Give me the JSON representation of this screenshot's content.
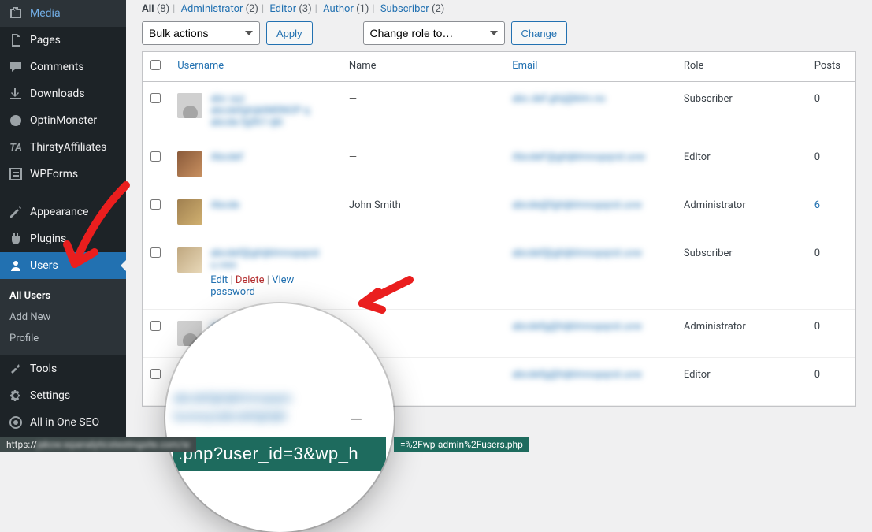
{
  "sidebar": {
    "items": [
      {
        "label": "Media",
        "icon": "media"
      },
      {
        "label": "Pages",
        "icon": "pages"
      },
      {
        "label": "Comments",
        "icon": "comments"
      },
      {
        "label": "Downloads",
        "icon": "downloads"
      },
      {
        "label": "OptinMonster",
        "icon": "optinmonster"
      },
      {
        "label": "ThirstyAffiliates",
        "icon": "ta"
      },
      {
        "label": "WPForms",
        "icon": "wpforms"
      },
      {
        "label": "Appearance",
        "icon": "appearance"
      },
      {
        "label": "Plugins",
        "icon": "plugins"
      },
      {
        "label": "Users",
        "icon": "users"
      },
      {
        "label": "Tools",
        "icon": "tools"
      },
      {
        "label": "Settings",
        "icon": "settings"
      },
      {
        "label": "All in One SEO",
        "icon": "aioseo"
      }
    ],
    "sub": {
      "items": [
        {
          "label": "All Users"
        },
        {
          "label": "Add New"
        },
        {
          "label": "Profile"
        }
      ]
    }
  },
  "filters": {
    "all_label": "All",
    "all_count": "(8)",
    "admin_label": "Administrator",
    "admin_count": "(2)",
    "editor_label": "Editor",
    "editor_count": "(3)",
    "author_label": "Author",
    "author_count": "(1)",
    "subscriber_label": "Subscriber",
    "subscriber_count": "(2)"
  },
  "actions": {
    "bulk_placeholder": "Bulk actions",
    "apply_label": "Apply",
    "role_placeholder": "Change role to…",
    "change_label": "Change"
  },
  "columns": {
    "username": "Username",
    "name": "Name",
    "email": "Email",
    "role": "Role",
    "posts": "Posts"
  },
  "rows": [
    {
      "username": "———",
      "name": "—",
      "email": "———",
      "role": "Subscriber",
      "posts": "0"
    },
    {
      "username": "———",
      "name": "—",
      "email": "———",
      "role": "Editor",
      "posts": "0"
    },
    {
      "username": "———",
      "name": "John Smith",
      "email": "———",
      "role": "Administrator",
      "posts": "6"
    },
    {
      "username": "———",
      "name": "",
      "email": "———",
      "role": "Subscriber",
      "posts": "0"
    },
    {
      "username": "———",
      "name": "",
      "email": "———",
      "role": "Administrator",
      "posts": "0"
    },
    {
      "username": "———",
      "name": "",
      "email": "———",
      "role": "Editor",
      "posts": "0"
    }
  ],
  "row_actions": {
    "edit": "Edit",
    "delete": "Delete",
    "view": "View",
    "password": "password"
  },
  "magnifier": {
    "url_text": ".php?user_id=3&wp_h",
    "dash": "—"
  },
  "status": {
    "left_prefix": "https://",
    "left_blur": "jakow.wpanalyticstestingsite.com/w",
    "right": "=%2Fwp-admin%2Fusers.php"
  }
}
